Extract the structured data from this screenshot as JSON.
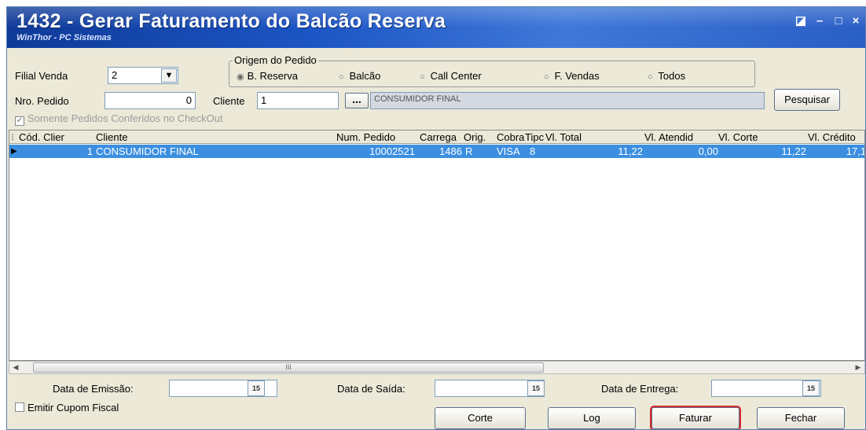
{
  "window": {
    "title": "1432 - Gerar Faturamento do Balcão Reserva",
    "subtitle": "WinThor - PC Sistemas",
    "controls": [
      "◪",
      "–",
      "□",
      "×"
    ]
  },
  "filters": {
    "filial_label": "Filial Venda",
    "filial_value": "2",
    "origem_title": "Origem do Pedido",
    "origem_options": [
      "B. Reserva",
      "Balcão",
      "Call Center",
      "F. Vendas",
      "Todos"
    ],
    "origem_selected": "B. Reserva",
    "pedido_label": "Nro. Pedido",
    "pedido_value": "0",
    "cliente_label": "Cliente",
    "cliente_value": "1",
    "cliente_btn": "...",
    "cliente_name": "CONSUMIDOR FINAL",
    "pesquisar_label": "Pesquisar",
    "somente_label": "Somente Pedidos Conferidos no CheckOut"
  },
  "grid": {
    "columns": [
      "Cód. Clier",
      "Cliente",
      "Num. Pedido",
      "Carrega",
      "Orig.",
      "Cobra",
      "Tipc",
      "Vl. Total",
      "Vl. Atendid",
      "Vl. Corte",
      "Vl. Crédito"
    ],
    "rows": [
      [
        "1",
        "CONSUMIDOR FINAL",
        "10002521",
        "1486",
        "R",
        "VISA",
        "8",
        "11,22",
        "0,00",
        "11,22",
        "17,1"
      ]
    ]
  },
  "scrollbar": {
    "thumb_mark": "III"
  },
  "footer": {
    "emissao_label": "Data de Emissão:",
    "saida_label": "Data de Saída:",
    "entrega_label": "Data de Entrega:",
    "calendar_icon_text": "15",
    "cupom_label": "Emitir Cupom Fiscal",
    "corte_label": "Corte",
    "log_label": "Log",
    "faturar_label": "Faturar",
    "fechar_label": "Fechar"
  },
  "colors": {
    "title_bar": "#1c55c4",
    "selected_row": "#3c8fe0",
    "highlight_outline": "#d62b2b"
  }
}
